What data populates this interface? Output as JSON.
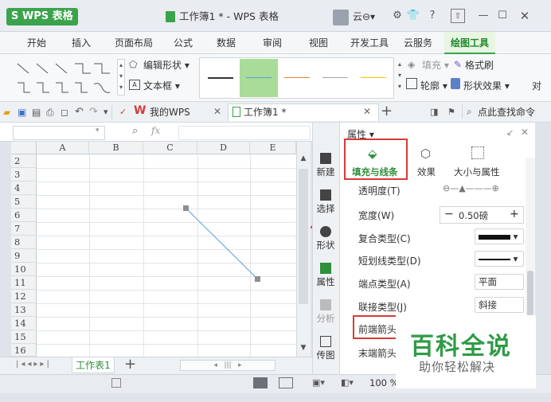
{
  "app": {
    "logo_text": "S WPS 表格",
    "doc_title": "工作簿1 * - WPS 表格",
    "cloud_user": "云⊖▾"
  },
  "menu": {
    "tabs": [
      "开始",
      "插入",
      "页面布局",
      "公式",
      "数据",
      "审阅",
      "视图",
      "开发工具",
      "云服务",
      "绘图工具"
    ],
    "active": "绘图工具"
  },
  "ribbon": {
    "edit_shape": "编辑形状 ▾",
    "text_box": "文本框 ▾",
    "fill": "填充 ▾",
    "format_brush": "格式刷",
    "outline": "轮廓 ▾",
    "shape_effect": "形状效果 ▾",
    "more": "对"
  },
  "colors": {
    "line_styles": [
      "#333333",
      "#5b9bd5",
      "#ed7d31",
      "#a5a5a5",
      "#ffc000"
    ],
    "accent": "#3aa34b",
    "red": "#d93a3a"
  },
  "doc_tabs": {
    "my_wps": "我的WPS",
    "workbook": "工作簿1 *",
    "find": "点此查找命令"
  },
  "formula": {
    "fx": "fx"
  },
  "grid": {
    "columns": [
      "A",
      "B",
      "C",
      "D",
      "E"
    ],
    "rows": [
      "2",
      "3",
      "4",
      "5",
      "6",
      "7",
      "8",
      "9",
      "10",
      "11",
      "12",
      "13",
      "14",
      "15",
      "16"
    ]
  },
  "sheet": {
    "tab": "工作表1",
    "add": "+"
  },
  "status": {
    "zoom": "100 % —"
  },
  "sidebar": {
    "items": [
      "新建",
      "选择",
      "形状",
      "属性",
      "分析",
      "传图"
    ]
  },
  "panel": {
    "title": "属性 ▾",
    "tabs": [
      "填充与线条",
      "效果",
      "大小与属性"
    ],
    "props": [
      {
        "label": "透明度(T)",
        "value": ""
      },
      {
        "label": "宽度(W)",
        "value": "0.50磅"
      },
      {
        "label": "复合类型(C)",
        "value": ""
      },
      {
        "label": "短划线类型(D)",
        "value": ""
      },
      {
        "label": "端点类型(A)",
        "value": "平面"
      },
      {
        "label": "联接类型(J)",
        "value": "斜接"
      },
      {
        "label": "前端箭头",
        "value": ""
      },
      {
        "label": "末端箭头",
        "value": ""
      }
    ]
  },
  "watermark": {
    "title": "百科全说",
    "subtitle": "助你轻松解决"
  }
}
